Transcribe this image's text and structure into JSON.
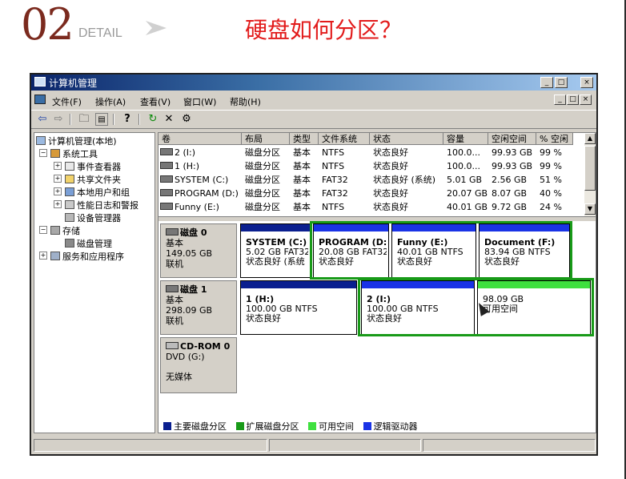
{
  "header": {
    "number": "02",
    "detail": "DETAIL",
    "headline": "硬盘如何分区？",
    "colors": {
      "number": "#7b2a1e",
      "headline": "#e21b1b"
    }
  },
  "window": {
    "title": "计算机管理",
    "buttons": {
      "minimize": "_",
      "maximize": "□",
      "close": "×"
    },
    "menu": [
      "文件(F)",
      "操作(A)",
      "查看(V)",
      "窗口(W)",
      "帮助(H)"
    ],
    "toolbar_icons": [
      "back-arrow-icon",
      "forward-arrow-icon",
      "up-folder-icon",
      "show-tree-icon",
      "help-icon",
      "refresh-icon",
      "delete-icon",
      "properties-icon"
    ]
  },
  "tree": [
    {
      "label": "计算机管理(本地)"
    },
    {
      "label": "系统工具"
    },
    {
      "label": "事件查看器"
    },
    {
      "label": "共享文件夹"
    },
    {
      "label": "本地用户和组"
    },
    {
      "label": "性能日志和警报"
    },
    {
      "label": "设备管理器"
    },
    {
      "label": "存储"
    },
    {
      "label": "磁盘管理"
    },
    {
      "label": "服务和应用程序"
    }
  ],
  "volume_columns": [
    "卷",
    "布局",
    "类型",
    "文件系统",
    "状态",
    "容量",
    "空闲空间",
    "% 空闲"
  ],
  "volumes": [
    {
      "name": "2 (I:)",
      "layout": "磁盘分区",
      "type": "基本",
      "fs": "NTFS",
      "status": "状态良好",
      "capacity": "100.0...",
      "free": "99.93 GB",
      "pct": "99 %"
    },
    {
      "name": "1 (H:)",
      "layout": "磁盘分区",
      "type": "基本",
      "fs": "NTFS",
      "status": "状态良好",
      "capacity": "100.0...",
      "free": "99.93 GB",
      "pct": "99 %"
    },
    {
      "name": "SYSTEM (C:)",
      "layout": "磁盘分区",
      "type": "基本",
      "fs": "FAT32",
      "status": "状态良好 (系统)",
      "capacity": "5.01 GB",
      "free": "2.56 GB",
      "pct": "51 %"
    },
    {
      "name": "PROGRAM (D:)",
      "layout": "磁盘分区",
      "type": "基本",
      "fs": "FAT32",
      "status": "状态良好",
      "capacity": "20.07 GB",
      "free": "8.07 GB",
      "pct": "40 %"
    },
    {
      "name": "Funny (E:)",
      "layout": "磁盘分区",
      "type": "基本",
      "fs": "NTFS",
      "status": "状态良好",
      "capacity": "40.01 GB",
      "free": "9.72 GB",
      "pct": "24 %"
    }
  ],
  "disks": [
    {
      "name": "磁盘 0",
      "kind": "基本",
      "size": "149.05 GB",
      "state": "联机",
      "partitions": [
        {
          "name": "SYSTEM (C:)",
          "detail": "5.02 GB FAT32",
          "status": "状态良好 (系统",
          "bar": "#0a1f8f"
        },
        {
          "name": "PROGRAM (D:)",
          "detail": "20.08 GB FAT32",
          "status": "状态良好",
          "bar": "#1a33e6"
        },
        {
          "name": "Funny (E:)",
          "detail": "40.01 GB NTFS",
          "status": "状态良好",
          "bar": "#1a33e6"
        },
        {
          "name": "Document (F:)",
          "detail": "83.94 GB NTFS",
          "status": "状态良好",
          "bar": "#1a33e6"
        }
      ]
    },
    {
      "name": "磁盘 1",
      "kind": "基本",
      "size": "298.09 GB",
      "state": "联机",
      "partitions": [
        {
          "name": "1 (H:)",
          "detail": "100.00 GB NTFS",
          "status": "状态良好",
          "bar": "#0a1f8f"
        },
        {
          "name": "2 (I:)",
          "detail": "100.00 GB NTFS",
          "status": "状态良好",
          "bar": "#1a33e6"
        },
        {
          "name": "",
          "detail": "98.09 GB",
          "status": "可用空间",
          "bar": "#3fe03f"
        }
      ]
    },
    {
      "name": "CD-ROM 0",
      "kind": "DVD (G:)",
      "size": "",
      "state": "无媒体",
      "partitions": []
    }
  ],
  "legend": [
    {
      "label": "主要磁盘分区",
      "color": "#0a1f8f"
    },
    {
      "label": "扩展磁盘分区",
      "color": "#189a18"
    },
    {
      "label": "可用空间",
      "color": "#3fe03f"
    },
    {
      "label": "逻辑驱动器",
      "color": "#1a33e6"
    }
  ]
}
